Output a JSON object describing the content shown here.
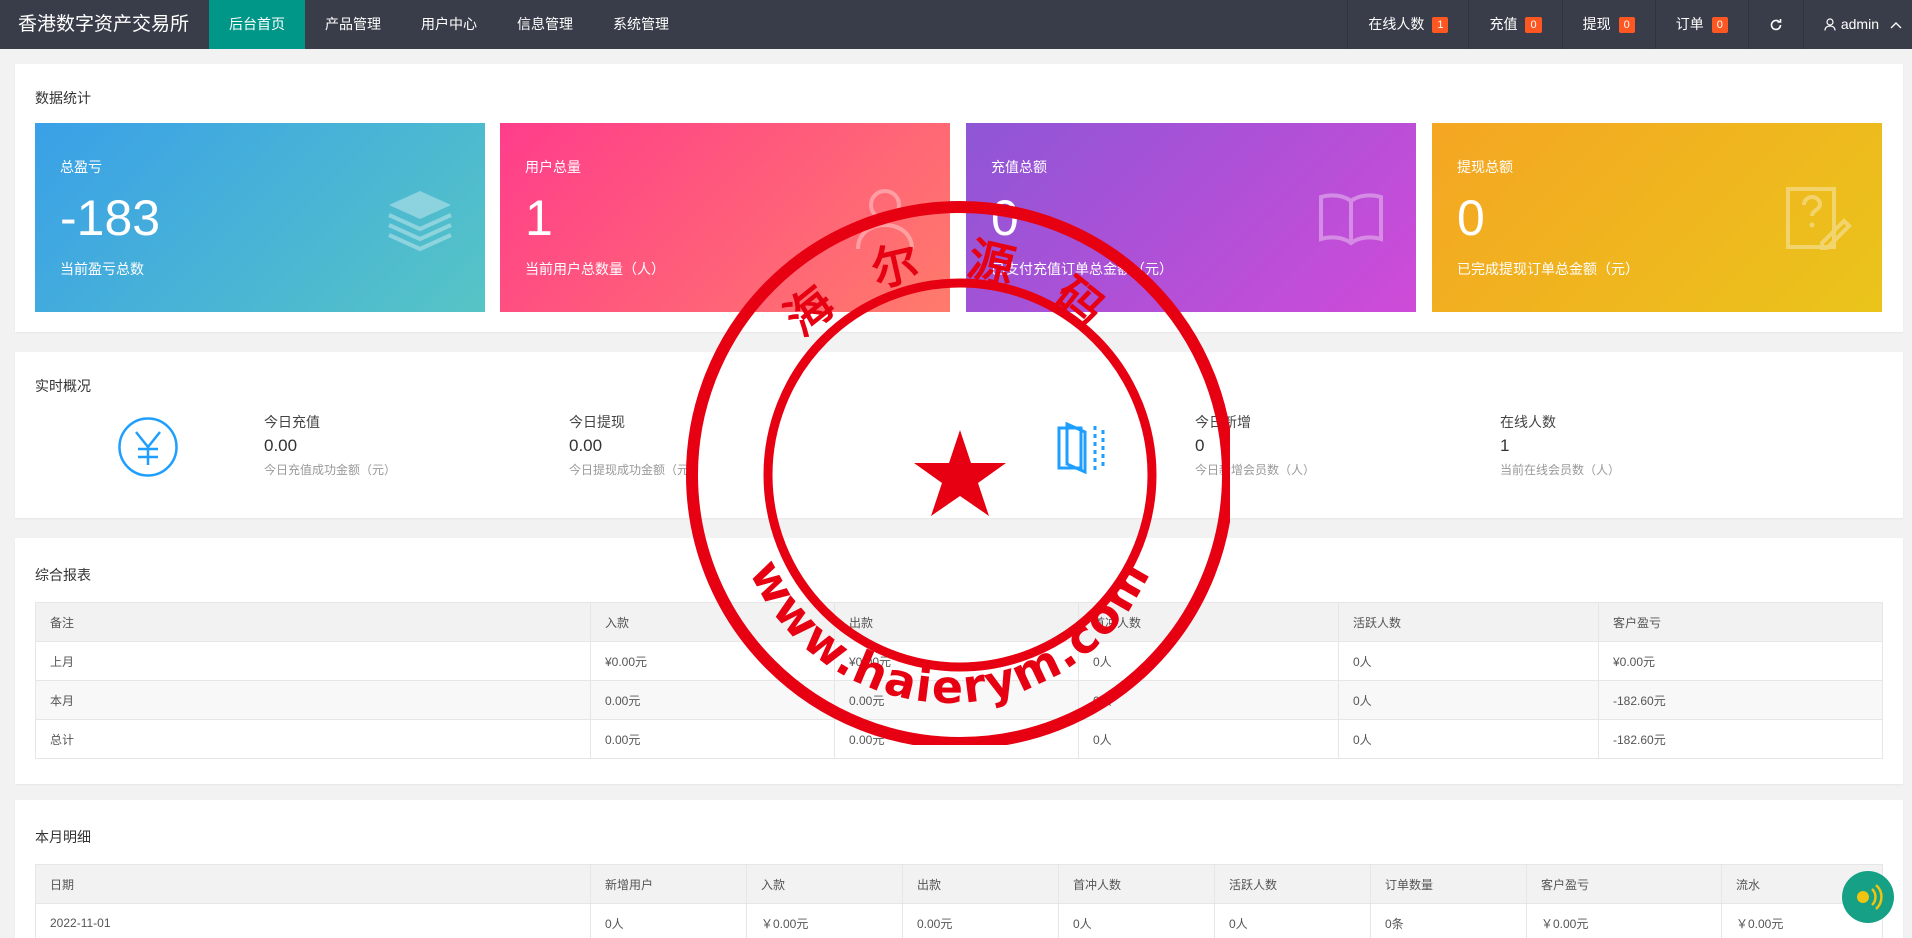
{
  "header": {
    "brand": "香港数字资产交易所",
    "nav": [
      "后台首页",
      "产品管理",
      "用户中心",
      "信息管理",
      "系统管理"
    ],
    "right": [
      {
        "label": "在线人数",
        "badge": "1"
      },
      {
        "label": "充值",
        "badge": "0"
      },
      {
        "label": "提现",
        "badge": "0"
      },
      {
        "label": "订单",
        "badge": "0"
      }
    ],
    "user": "admin"
  },
  "stats": {
    "title": "数据统计",
    "tiles": [
      {
        "label": "总盈亏",
        "value": "-183",
        "sub": "当前盈亏总数",
        "icon": "layers-icon",
        "color_from": "#3aa0e8",
        "color_to": "#56c5c5"
      },
      {
        "label": "用户总量",
        "value": "1",
        "sub": "当前用户总数量（人）",
        "icon": "user-icon",
        "color_from": "#ff3d8b",
        "color_to": "#ff7b6b"
      },
      {
        "label": "充值总额",
        "value": "0",
        "sub": "已支付充值订单总金额（元）",
        "icon": "book-icon",
        "color_from": "#8e56d6",
        "color_to": "#cf4bd8"
      },
      {
        "label": "提现总额",
        "value": "0",
        "sub": "已完成提现订单总金额（元）",
        "icon": "note-edit-icon",
        "color_from": "#f5a623",
        "color_to": "#eac41b"
      }
    ]
  },
  "realtime": {
    "title": "实时概况",
    "items": [
      {
        "label": "今日充值",
        "value": "0.00",
        "sub": "今日充值成功金额（元）"
      },
      {
        "label": "今日提现",
        "value": "0.00",
        "sub": "今日提现成功金额（元）"
      },
      {
        "label": "今日新增",
        "value": "0",
        "sub": "今日新增会员数（人）"
      },
      {
        "label": "在线人数",
        "value": "1",
        "sub": "当前在线会员数（人）"
      }
    ]
  },
  "report": {
    "title": "综合报表",
    "columns": [
      "备注",
      "入款",
      "出款",
      "首冲人数",
      "活跃人数",
      "客户盈亏"
    ],
    "rows": [
      [
        "上月",
        "¥0.00元",
        "¥0.00元",
        "0人",
        "0人",
        "¥0.00元"
      ],
      [
        "本月",
        "0.00元",
        "0.00元",
        "0人",
        "0人",
        "-182.60元"
      ],
      [
        "总计",
        "0.00元",
        "0.00元",
        "0人",
        "0人",
        "-182.60元"
      ]
    ]
  },
  "monthly": {
    "title": "本月明细",
    "columns": [
      "日期",
      "新增用户",
      "入款",
      "出款",
      "首冲人数",
      "活跃人数",
      "订单数量",
      "客户盈亏",
      "流水"
    ],
    "rows": [
      [
        "2022-11-01",
        "0人",
        "￥0.00元",
        "0.00元",
        "0人",
        "0人",
        "0条",
        "￥0.00元",
        "￥0.00元"
      ]
    ]
  },
  "watermark": {
    "top_text": "海 尔 源 码",
    "bottom_text": "www.haierym.com",
    "color": "#e60012"
  }
}
